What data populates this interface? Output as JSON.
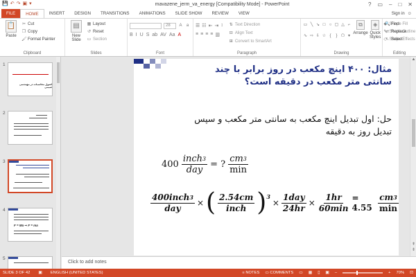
{
  "window": {
    "title": "mavazene_jerm_va_energy [Compatibility Mode] - PowerPoint",
    "controls": [
      "?",
      "▭",
      "–",
      "□",
      "✕"
    ]
  },
  "qat": [
    "💾",
    "↶",
    "↷",
    "▣",
    "▾"
  ],
  "tabs": [
    "FILE",
    "HOME",
    "INSERT",
    "DESIGN",
    "TRANSITIONS",
    "ANIMATIONS",
    "SLIDE SHOW",
    "REVIEW",
    "VIEW"
  ],
  "active_tab_index": 1,
  "signin": "Sign in",
  "ribbon": {
    "clipboard": {
      "label": "Clipboard",
      "paste": "Paste",
      "cut": "Cut",
      "copy": "Copy",
      "format_painter": "Format Painter"
    },
    "slides": {
      "label": "Slides",
      "new_slide": "New Slide",
      "layout": "Layout",
      "reset": "Reset",
      "section": "Section"
    },
    "font": {
      "label": "Font",
      "font_size": "28"
    },
    "paragraph": {
      "label": "Paragraph",
      "text_direction": "Text Direction",
      "align_text": "Align Text",
      "convert_smartart": "Convert to SmartArt"
    },
    "drawing": {
      "label": "Drawing",
      "arrange": "Arrange",
      "quick_styles": "Quick Styles",
      "shape_fill": "Shape Fill",
      "shape_outline": "Shape Outline",
      "shape_effects": "Shape Effects"
    },
    "editing": {
      "label": "Editing",
      "find": "Find",
      "replace": "Replace",
      "select": "Select"
    }
  },
  "thumbnails": [
    {
      "num": "1",
      "title": "اصول محاسبات در مهندسی شیمی"
    },
    {
      "num": "2"
    },
    {
      "num": "3"
    },
    {
      "num": "4",
      "formula": "F = Ma ⇒ F = ma"
    },
    {
      "num": "5"
    }
  ],
  "slide": {
    "title": "مثال: ۴۰۰ اینچ مکعب در روز برابر با چند سانتی متر مکعب در دقیقه است؟",
    "body": "حل: اول تبدیل اینچ مکعب به سانتی متر مکعب و سپس تبدیل روز به دقیقه",
    "eq1": {
      "lead": "400",
      "num1": "inch",
      "den1": "day",
      "mid": "= ?",
      "num2": "cm",
      "den2": "min",
      "exp": "3"
    },
    "eq2": {
      "f1_num": "400inch",
      "f1_den": "day",
      "f1_exp": "3",
      "f2_num": "2.54cm",
      "f2_den": "inch",
      "f2_exp": "3",
      "f3_num": "1day",
      "f3_den": "24hr",
      "f4_num": "1hr",
      "f4_den": "60min",
      "times": "×",
      "eq": "= 4.55",
      "r_num": "cm",
      "r_den": "min",
      "r_exp": "3"
    }
  },
  "notes_placeholder": "Click to add notes",
  "status": {
    "slide": "SLIDE 3 OF 42",
    "language": "ENGLISH (UNITED STATES)",
    "notes": "NOTES",
    "comments": "COMMENTS",
    "zoom": "70%",
    "zoom_fraction": 0.7
  },
  "colors": {
    "accent": "#d24726",
    "slide_blue": "#1f2f85"
  }
}
